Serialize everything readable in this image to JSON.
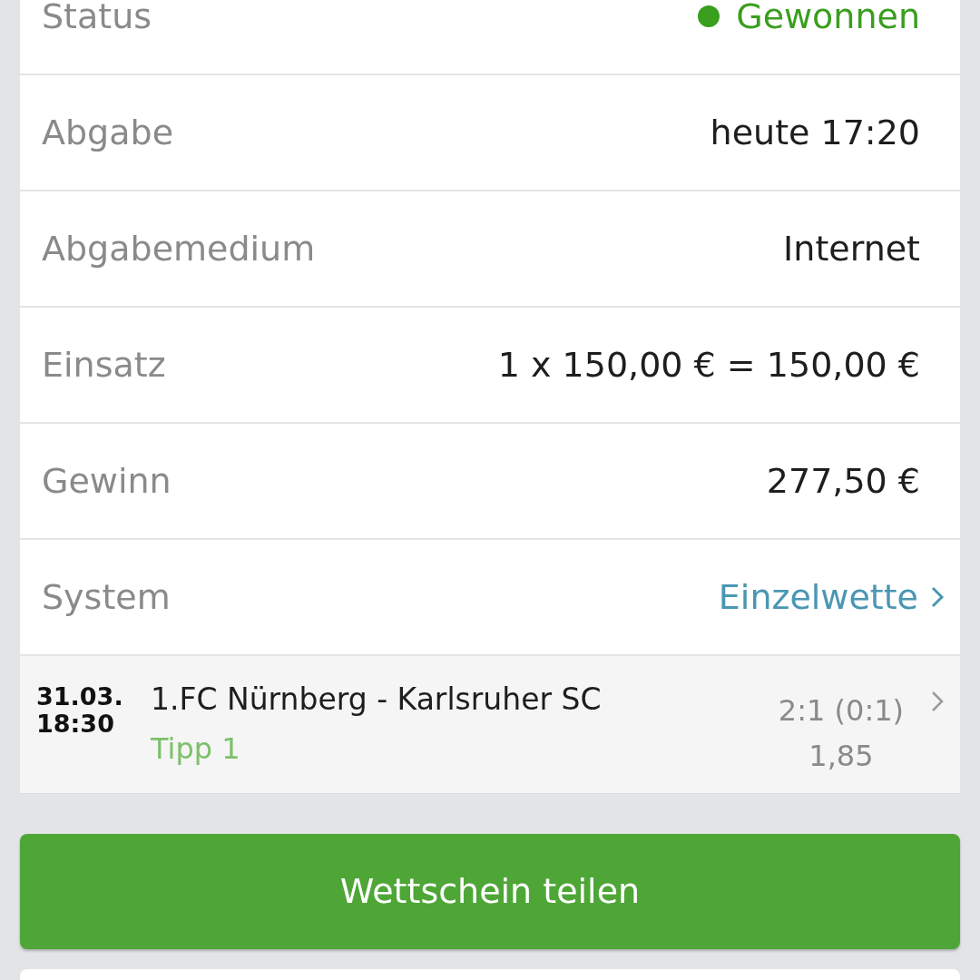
{
  "details": [
    {
      "kind": "status",
      "label": "Status",
      "value": "Gewonnen",
      "color": "#3a9e1e"
    },
    {
      "kind": "plain",
      "label": "Abgabe",
      "value": "heute 17:20"
    },
    {
      "kind": "plain",
      "label": "Abgabemedium",
      "value": "Internet"
    },
    {
      "kind": "plain",
      "label": "Einsatz",
      "value": "1 x 150,00 € = 150,00 €"
    },
    {
      "kind": "plain",
      "label": "Gewinn",
      "value": "277,50 €"
    },
    {
      "kind": "link",
      "label": "System",
      "value": "Einzelwette"
    }
  ],
  "match": {
    "date": "31.03.",
    "time": "18:30",
    "teams": "1.FC Nürnberg - Karlsruher SC",
    "tip": "Tipp 1",
    "result": "2:1 (0:1)",
    "odds": "1,85"
  },
  "share_button": "Wettschein teilen"
}
